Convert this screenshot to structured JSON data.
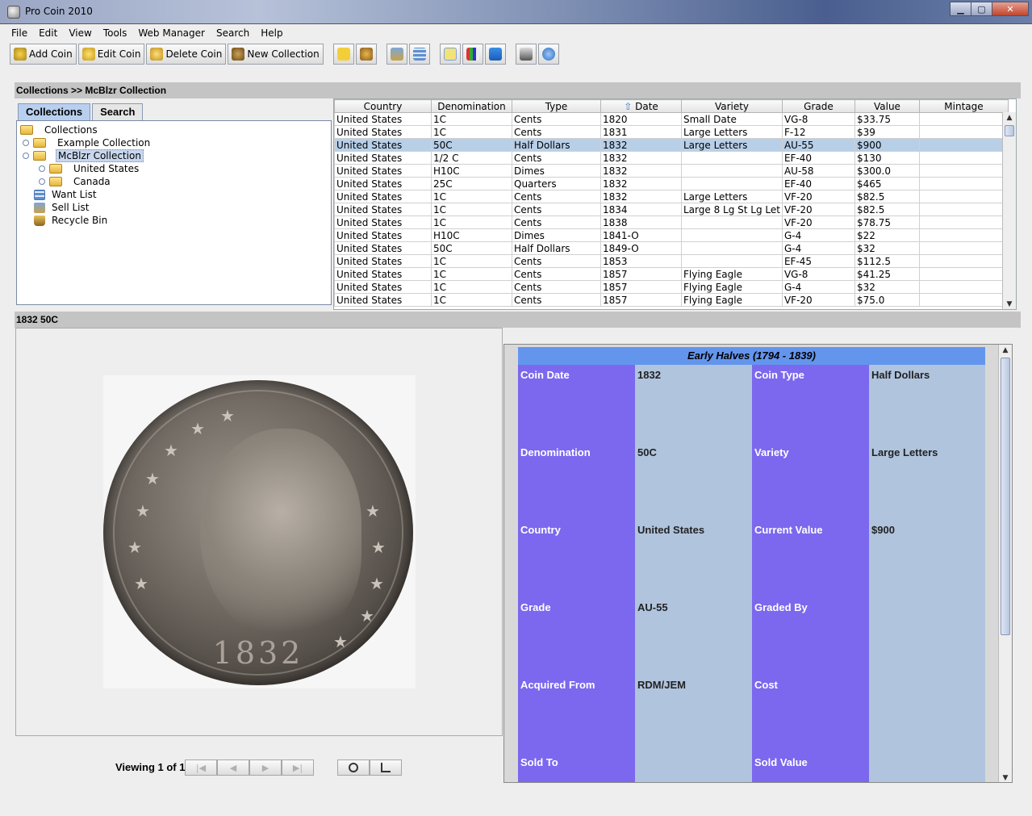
{
  "window": {
    "title": "Pro Coin 2010"
  },
  "menu": [
    "File",
    "Edit",
    "View",
    "Tools",
    "Web Manager",
    "Search",
    "Help"
  ],
  "toolbar": {
    "add_coin": "Add Coin",
    "edit_coin": "Edit Coin",
    "delete_coin": "Delete Coin",
    "new_collection": "New Collection"
  },
  "breadcrumb": "Collections >> McBlzr Collection",
  "tabs": {
    "collections": "Collections",
    "search": "Search"
  },
  "tree": {
    "root": "Collections",
    "example": "Example Collection",
    "mcblzr": "McBlzr Collection",
    "united_states": "United States",
    "canada": "Canada",
    "want_list": "Want List",
    "sell_list": "Sell List",
    "recycle_bin": "Recycle Bin"
  },
  "table": {
    "columns": [
      "Country",
      "Denomination",
      "Type",
      "Date",
      "Variety",
      "Grade",
      "Value",
      "Mintage"
    ],
    "rows": [
      [
        "United States",
        "1C",
        "Cents",
        "1820",
        "Small Date",
        "VG-8",
        "$33.75",
        ""
      ],
      [
        "United States",
        "1C",
        "Cents",
        "1831",
        "Large Letters",
        "F-12",
        "$39",
        ""
      ],
      [
        "United States",
        "50C",
        "Half Dollars",
        "1832",
        "Large Letters",
        "AU-55",
        "$900",
        ""
      ],
      [
        "United States",
        "1/2 C",
        "Cents",
        "1832",
        "",
        "EF-40",
        "$130",
        ""
      ],
      [
        "United States",
        "H10C",
        "Dimes",
        "1832",
        "",
        "AU-58",
        "$300.0",
        ""
      ],
      [
        "United States",
        "25C",
        "Quarters",
        "1832",
        "",
        "EF-40",
        "$465",
        ""
      ],
      [
        "United States",
        "1C",
        "Cents",
        "1832",
        "Large Letters",
        "VF-20",
        "$82.5",
        ""
      ],
      [
        "United States",
        "1C",
        "Cents",
        "1834",
        "Large 8 Lg St Lg Let",
        "VF-20",
        "$82.5",
        ""
      ],
      [
        "United States",
        "1C",
        "Cents",
        "1838",
        "",
        "VF-20",
        "$78.75",
        ""
      ],
      [
        "United States",
        "H10C",
        "Dimes",
        "1841-O",
        "",
        "G-4",
        "$22",
        ""
      ],
      [
        "United States",
        "50C",
        "Half Dollars",
        "1849-O",
        "",
        "G-4",
        "$32",
        ""
      ],
      [
        "United States",
        "1C",
        "Cents",
        "1853",
        "",
        "EF-45",
        "$112.5",
        ""
      ],
      [
        "United States",
        "1C",
        "Cents",
        "1857",
        "Flying Eagle",
        "VG-8",
        "$41.25",
        ""
      ],
      [
        "United States",
        "1C",
        "Cents",
        "1857",
        "Flying Eagle",
        "G-4",
        "$32",
        ""
      ],
      [
        "United States",
        "1C",
        "Cents",
        "1857",
        "Flying Eagle",
        "VF-20",
        "$75.0",
        ""
      ]
    ],
    "selected_row": 2
  },
  "detail": {
    "header": "1832 50C",
    "coin_year": "1832",
    "viewing": "Viewing 1 of 1"
  },
  "info": {
    "title": "Early Halves (1794 - 1839)",
    "fields": [
      [
        "Coin Date",
        "1832",
        "Coin Type",
        "Half Dollars"
      ],
      [
        "Denomination",
        "50C",
        "Variety",
        "Large Letters"
      ],
      [
        "Country",
        "United States",
        "Current Value",
        "$900"
      ],
      [
        "Grade",
        "AU-55",
        "Graded By",
        ""
      ],
      [
        "Acquired From",
        "RDM/JEM",
        "Cost",
        ""
      ],
      [
        "Sold To",
        "",
        "Sold Value",
        ""
      ]
    ]
  },
  "colors": {
    "info_title": "#6495ed",
    "info_key": "#7b68ee",
    "info_value": "#b0c4de",
    "selected_row": "#b8cfe8"
  }
}
